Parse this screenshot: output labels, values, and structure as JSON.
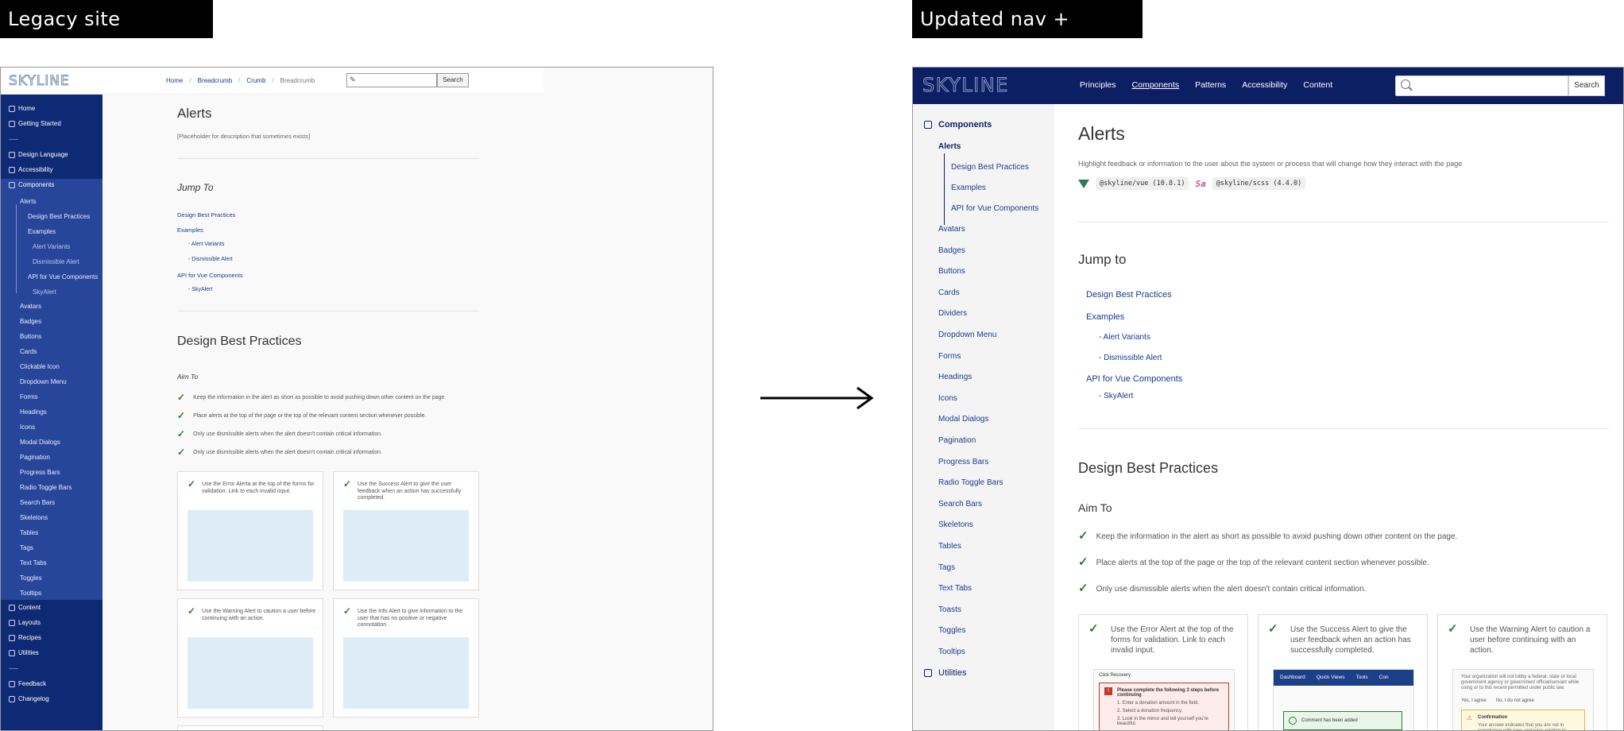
{
  "captions": {
    "left": "Legacy site structure",
    "right": "Updated nav + content"
  },
  "legacy": {
    "logo": "SKYLINE",
    "breadcrumbs": [
      "Home",
      "Breadcrumb",
      "Crumb",
      "Breadcrumb"
    ],
    "search_button": "Search",
    "sidebar_top": [
      "Home",
      "Getting Started"
    ],
    "sidebar_mid": [
      "Design Language",
      "Accessibility",
      "Components"
    ],
    "components_sub": [
      "Alerts",
      "Design Best Practices",
      "Examples",
      "Alert Variants",
      "Dismissible Alert",
      "API for Vue Components",
      "SkyAlert"
    ],
    "components_list": [
      "Avatars",
      "Badges",
      "Buttons",
      "Cards",
      "Clickable Icon",
      "Dropdown Menu",
      "Forms",
      "Headings",
      "Icons",
      "Modal Dialogs",
      "Pagination",
      "Progress Bars",
      "Radio Toggle Bars",
      "Search Bars",
      "Skeletons",
      "Tables",
      "Tags",
      "Text Tabs",
      "Toggles",
      "Tooltips"
    ],
    "sidebar_bottom": [
      "Content",
      "Layouts",
      "Recipes",
      "Utilities"
    ],
    "sidebar_footer": [
      "Feedback",
      "Changelog"
    ],
    "title": "Alerts",
    "description": "[Placeholder for description that sometimes exists]",
    "jump_to": "Jump To",
    "jump_links": {
      "best": "Design Best Practices",
      "examples": "Examples",
      "variants": "- Alert Variants",
      "dismissible": "- Dismissible Alert",
      "api": "API for Vue Components",
      "skyalert": "- SkyAlert"
    },
    "section_title": "Design Best Practices",
    "aim_to": "Aim To",
    "bullets": [
      "Keep the information in the alert as short as possible to avoid pushing down other content on the page.",
      "Place alerts at the top of the page or the top of the relevant content section whenever possible.",
      "Only use dismissible alerts when the alert doesn't contain critical information.",
      "Only use dismissible alerts when the alert doesn't contain critical information."
    ],
    "cards": [
      "Use the Error Alerta at the top of the forms for validation. Link to each invalid input.",
      "Use the Success Alert to give the user feedback when an action has successfully completed.",
      "Use the Warning Alert to caution a user before continuing with an action.",
      "Use the Info Alert to give information to the user that has no positive or negative connotation."
    ]
  },
  "updated": {
    "logo": "SKYLINE",
    "nav": [
      "Principles",
      "Components",
      "Patterns",
      "Accessibility",
      "Content"
    ],
    "search_button": "Search",
    "sidebar_head": "Components",
    "alerts": "Alerts",
    "alerts_sub": [
      "Design Best Practices",
      "Examples",
      "API for Vue Components"
    ],
    "components_list": [
      "Avatars",
      "Badges",
      "Buttons",
      "Cards",
      "Dividers",
      "Dropdown Menu",
      "Forms",
      "Headings",
      "Icons",
      "Modal Dialogs",
      "Pagination",
      "Progress Bars",
      "Radio Toggle Bars",
      "Search Bars",
      "Skeletons",
      "Tables",
      "Tags",
      "Text Tabs",
      "Toasts",
      "Toggles",
      "Tooltips"
    ],
    "utilities": "Utilities",
    "title": "Alerts",
    "description": "Highlight feedback or information to the user about the system or process that will change how they interact with the page",
    "pkg_vue": "@skyline/vue (10.8.1)",
    "pkg_scss": "@skyline/scss (4.4.0)",
    "jump_to": "Jump to",
    "jump_links": {
      "best": "Design Best Practices",
      "examples": "Examples",
      "variants": "- Alert Variants",
      "dismissible": "- Dismissible Alert",
      "api": "API for Vue Components",
      "skyalert": "- SkyAlert"
    },
    "section_title": "Design Best Practices",
    "aim_to": "Aim To",
    "bullets": [
      "Keep the information in the alert as short as possible to avoid pushing down other content on the page.",
      "Place alerts at the top of the page or the top of the relevant content section whenever possible.",
      "Only use dismissible alerts when the alert doesn't contain critical information."
    ],
    "cards": [
      "Use the Error Alert at the top of the forms for validation. Link to each invalid input.",
      "Use the Success Alert to give the user feedback when an action has successfully completed.",
      "Use the Warning Alert to caution a user before continuing with an action."
    ],
    "shot_error": {
      "top": "Click Recovery",
      "title": "Please complete the following 3 steps before continuing",
      "items": [
        "1. Enter a donation amount in the field.",
        "2. Select a donation frequency.",
        "3. Look in the mirror and tell yourself you're beautiful."
      ]
    },
    "shot_success": {
      "nav": [
        "Dashboard",
        "Quick Views",
        "Tools",
        "Con"
      ],
      "message": "Comment has been added"
    },
    "shot_warning": {
      "intro": "Your organization will not lobby a federal, state or local government agency or government official/servant while using or to this recent permitted under public law.",
      "yes": "Yes, I agree",
      "no": "No, I do not agree",
      "title": "Confirmation",
      "desc": "Your answer indicates that you are not in compliance with laws and rules relating to lobbying activity."
    }
  },
  "colors": {
    "legacy_sidebar": "#0e2a74",
    "updated_topbar": "#0d1f63",
    "link": "#1c3b8e",
    "check": "#2e7d32"
  }
}
